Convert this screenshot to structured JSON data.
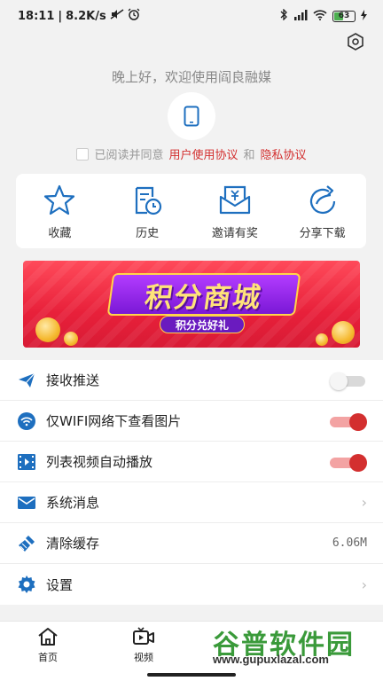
{
  "status_bar": {
    "time": "18:11",
    "speed": "8.2K/s",
    "battery": "63"
  },
  "greeting": "晚上好，欢迎使用阎良融媒",
  "agreement": {
    "prefix": "已阅读并同意",
    "user_agreement": "用户使用协议",
    "and": "和",
    "privacy": "隐私协议"
  },
  "quick_actions": [
    {
      "label": "收藏",
      "icon": "star-icon"
    },
    {
      "label": "历史",
      "icon": "history-icon"
    },
    {
      "label": "邀请有奖",
      "icon": "invite-reward-icon"
    },
    {
      "label": "分享下载",
      "icon": "share-icon"
    }
  ],
  "banner": {
    "title": "积分商城",
    "subtitle": "积分兑好礼"
  },
  "settings": [
    {
      "label": "接收推送",
      "icon": "send-icon",
      "control": "toggle",
      "on": false
    },
    {
      "label": "仅WIFI网络下查看图片",
      "icon": "wifi-icon",
      "control": "toggle",
      "on": true
    },
    {
      "label": "列表视频自动播放",
      "icon": "video-icon",
      "control": "toggle",
      "on": true
    },
    {
      "label": "系统消息",
      "icon": "mail-icon",
      "control": "chevron"
    },
    {
      "label": "清除缓存",
      "icon": "clean-icon",
      "control": "value",
      "value": "6.06M"
    },
    {
      "label": "设置",
      "icon": "gear-icon",
      "control": "chevron"
    }
  ],
  "bottom_nav": [
    {
      "label": "首页",
      "icon": "home-icon"
    },
    {
      "label": "视频",
      "icon": "video-play-icon"
    }
  ],
  "watermark": {
    "title": "谷普软件园",
    "url": "www.gupuxlazal.com"
  },
  "colors": {
    "accent_blue": "#1e6fbf",
    "accent_red": "#d32f2f"
  }
}
